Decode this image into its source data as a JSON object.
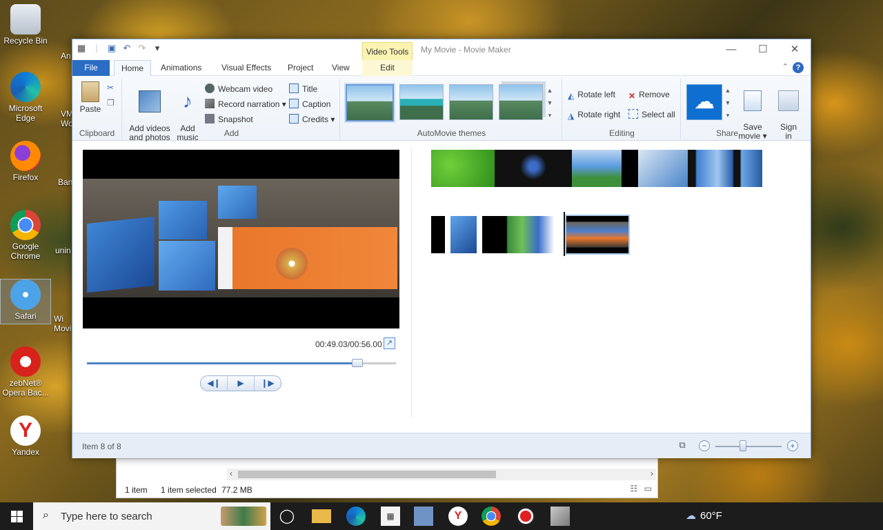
{
  "desktop": {
    "icons": [
      {
        "label": "Recycle Bin",
        "icon": "recycle-bin-icon"
      },
      {
        "label": "Microsoft\nEdge",
        "icon": "edge-icon"
      },
      {
        "label": "Firefox",
        "icon": "firefox-icon"
      },
      {
        "label": "Google\nChrome",
        "icon": "chrome-icon"
      },
      {
        "label": "Safari",
        "icon": "safari-icon"
      },
      {
        "label": "zebNet®\nOpera Bac...",
        "icon": "zebnet-icon"
      },
      {
        "label": "Yandex",
        "icon": "yandex-icon"
      }
    ],
    "partial_labels": [
      "An",
      "VM\nWo",
      "Ban",
      "unin",
      "Wi\nMovi"
    ]
  },
  "window": {
    "title": "My Movie - Movie Maker",
    "contextual_tab_group": "Video Tools",
    "controls": {
      "minimize": "—",
      "maximize": "☐",
      "close": "✕"
    }
  },
  "tabs": {
    "file": "File",
    "home": "Home",
    "animations": "Animations",
    "visual_effects": "Visual Effects",
    "project": "Project",
    "view": "View",
    "edit": "Edit"
  },
  "ribbon": {
    "clipboard": {
      "label": "Clipboard",
      "paste": "Paste"
    },
    "add": {
      "label": "Add",
      "add_videos": "Add videos\nand photos",
      "add_music": "Add\nmusic ▾",
      "webcam": "Webcam video",
      "narration": "Record narration ▾",
      "snapshot": "Snapshot",
      "title": "Title",
      "caption": "Caption",
      "credits": "Credits ▾"
    },
    "automovie": {
      "label": "AutoMovie themes"
    },
    "editing": {
      "label": "Editing",
      "rotate_left": "Rotate left",
      "rotate_right": "Rotate right",
      "remove": "Remove",
      "select_all": "Select all"
    },
    "share": {
      "label": "Share",
      "save_movie": "Save\nmovie ▾",
      "sign_in": "Sign\nin"
    }
  },
  "preview": {
    "timecode": "00:49.03/00:56.00",
    "progress": 0.875
  },
  "status": {
    "item": "Item 8 of 8",
    "zoom_level": 0.42
  },
  "explorer": {
    "items": "1 item",
    "selected": "1 item selected",
    "size": "77.2 MB"
  },
  "taskbar": {
    "search_placeholder": "Type here to search",
    "weather": "60°F"
  },
  "colors": {
    "accent": "#2b6cc4",
    "videotools": "#fbf3b2"
  }
}
